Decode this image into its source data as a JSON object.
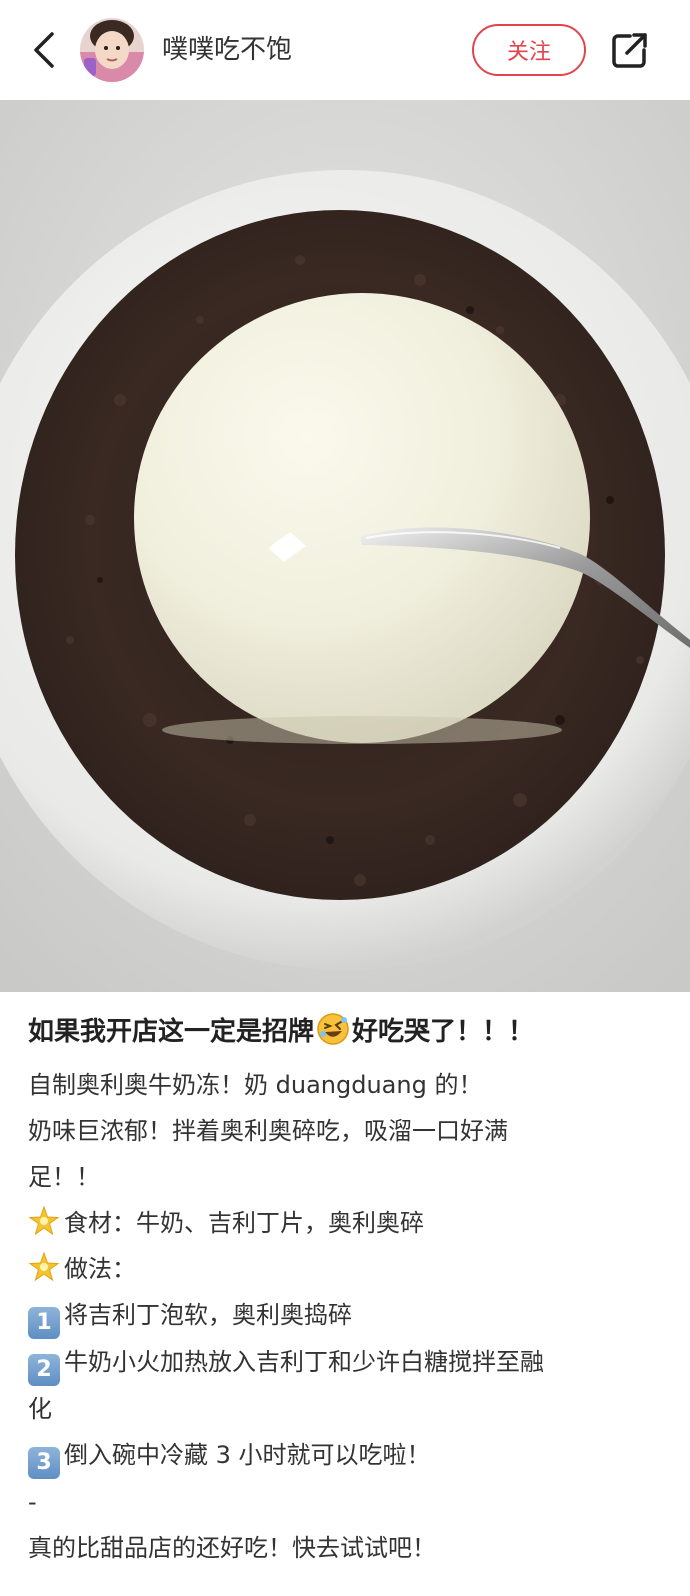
{
  "header": {
    "username": "噗噗吃不饱",
    "follow_label": "关注"
  },
  "post": {
    "title_part1": "如果我开店这一定是招牌",
    "title_emoji": "rolling-on-floor-laughing-icon",
    "title_part2": "好吃哭了！！！",
    "lines": {
      "l1": "自制奥利奥牛奶冻！奶 duangduang 的！",
      "l2": "奶味巨浓郁！拌着奥利奥碎吃，吸溜一口好满",
      "l3": "足！！",
      "l4": "食材：牛奶、吉利丁片，奥利奥碎",
      "l5": "做法：",
      "l6": "将吉利丁泡软，奥利奥捣碎",
      "l7": "牛奶小火加热放入吉利丁和少许白糖搅拌至融",
      "l8": "化",
      "l9": "倒入碗中冷藏 3 小时就可以吃啦！",
      "l10": "-",
      "l11": "真的比甜品店的还好吃！快去试试吧！"
    },
    "step_numbers": {
      "n1": "1",
      "n2": "2",
      "n3": "3"
    }
  },
  "colors": {
    "accent": "#e2444b",
    "text": "#333333"
  }
}
